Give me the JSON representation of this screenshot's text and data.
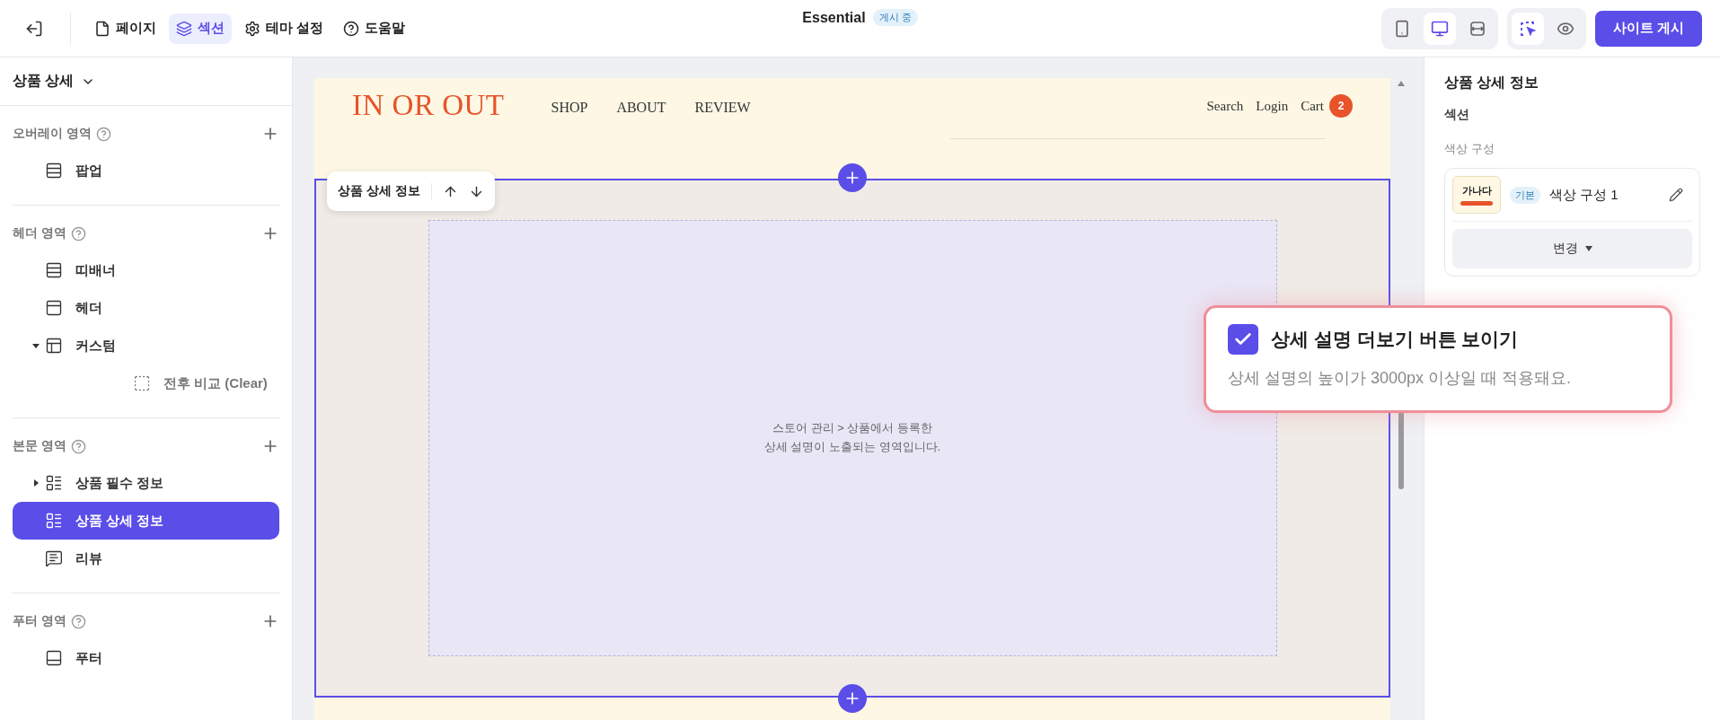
{
  "topbar": {
    "nav": [
      {
        "label": "페이지",
        "kind": "page",
        "selected": false
      },
      {
        "label": "섹션",
        "kind": "section",
        "selected": true
      },
      {
        "label": "테마 설정",
        "kind": "theme",
        "selected": false
      },
      {
        "label": "도움말",
        "kind": "help",
        "selected": false
      }
    ],
    "site_name": "Essential",
    "status_badge": "게시 중",
    "devices": [
      {
        "kind": "mobile",
        "selected": false
      },
      {
        "kind": "desktop",
        "selected": true
      },
      {
        "kind": "full",
        "selected": false
      }
    ],
    "modes": [
      {
        "kind": "select",
        "selected": true
      },
      {
        "kind": "preview",
        "selected": false
      }
    ],
    "publish_button": "사이트 게시"
  },
  "sidebar": {
    "page_title": "상품 상세",
    "sections": [
      {
        "label": "오버레이 영역",
        "items": [
          {
            "label": "팝업",
            "kind": "popup",
            "selected": false
          }
        ]
      },
      {
        "label": "헤더 영역",
        "items": [
          {
            "label": "띠배너",
            "kind": "banner",
            "selected": false
          },
          {
            "label": "헤더",
            "kind": "header",
            "selected": false
          },
          {
            "label": "커스텀",
            "kind": "custom",
            "selected": false,
            "expanded": true,
            "children": [
              {
                "label": "전후 비교 (Clear)",
                "kind": "blank",
                "selected": false
              }
            ]
          }
        ]
      },
      {
        "label": "본문 영역",
        "items": [
          {
            "label": "상품 필수 정보",
            "kind": "info",
            "selected": false,
            "expanded": false
          },
          {
            "label": "상품 상세 정보",
            "kind": "info",
            "selected": true
          },
          {
            "label": "리뷰",
            "kind": "review",
            "selected": false
          }
        ]
      },
      {
        "label": "푸터 영역",
        "items": [
          {
            "label": "푸터",
            "kind": "footer",
            "selected": false
          }
        ]
      }
    ]
  },
  "preview": {
    "logo": "IN OR OUT",
    "menu": [
      "SHOP",
      "ABOUT",
      "REVIEW"
    ],
    "links": [
      "Search",
      "Login",
      "Cart"
    ],
    "cart_count": "2",
    "section_toolbar": {
      "title": "상품 상세 정보"
    },
    "placeholder_text": "스토어 관리 > 상품에서 등록한\n상세 설명이 노출되는 영역입니다."
  },
  "inspector": {
    "title": "상품 상세 정보",
    "group": "섹션",
    "color_label": "색상 구성",
    "color_scheme": {
      "swatch_text": "가나다",
      "badge": "기본",
      "name": "색상 구성 1",
      "change_button": "변경"
    }
  },
  "callout": {
    "label": "상세 설명 더보기 버튼 보이기",
    "checked": true,
    "description": "상세 설명의 높이가 3000px 이상일 때 적용돼요."
  }
}
